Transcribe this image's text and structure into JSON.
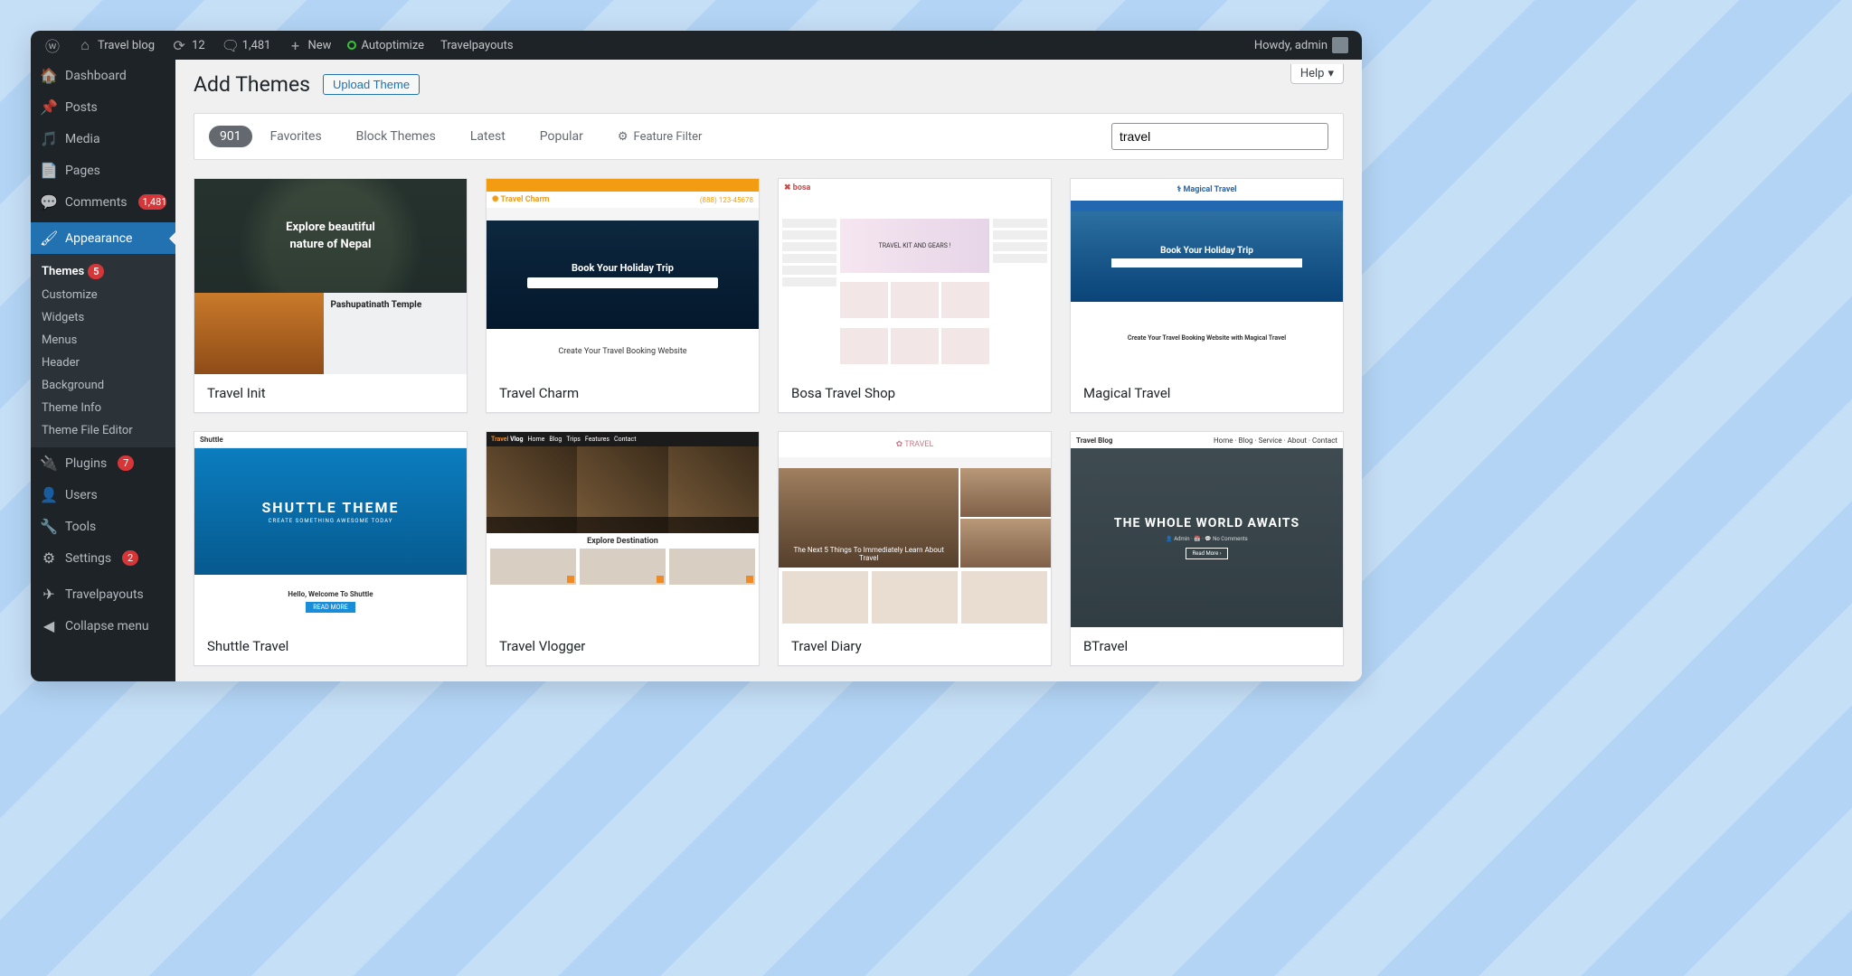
{
  "adminbar": {
    "site_name": "Travel blog",
    "updates": "12",
    "comments": "1,481",
    "new_label": "New",
    "autoptimize": "Autoptimize",
    "travelpayouts": "Travelpayouts",
    "howdy_label": "Howdy, admin"
  },
  "sidebar": {
    "items": [
      {
        "icon": "🏠",
        "label": "Dashboard"
      },
      {
        "icon": "📌",
        "label": "Posts"
      },
      {
        "icon": "🎵",
        "label": "Media"
      },
      {
        "icon": "📄",
        "label": "Pages"
      },
      {
        "icon": "💬",
        "label": "Comments",
        "badge": "1,481"
      },
      {
        "icon": "🖌",
        "label": "Appearance",
        "current": true
      },
      {
        "icon": "🔌",
        "label": "Plugins",
        "badge": "7"
      },
      {
        "icon": "👤",
        "label": "Users"
      },
      {
        "icon": "🔧",
        "label": "Tools"
      },
      {
        "icon": "⚙",
        "label": "Settings",
        "badge": "2"
      },
      {
        "icon": "✈",
        "label": "Travelpayouts"
      },
      {
        "icon": "◀",
        "label": "Collapse menu"
      }
    ],
    "appearance_submenu": [
      {
        "label": "Themes",
        "badge": "5",
        "current": true
      },
      {
        "label": "Customize"
      },
      {
        "label": "Widgets"
      },
      {
        "label": "Menus"
      },
      {
        "label": "Header"
      },
      {
        "label": "Background"
      },
      {
        "label": "Theme Info"
      },
      {
        "label": "Theme File Editor"
      }
    ]
  },
  "page": {
    "help": "Help",
    "title": "Add Themes",
    "upload_label": "Upload Theme",
    "count": "901",
    "filters": [
      "Popular",
      "Latest",
      "Block Themes",
      "Favorites"
    ],
    "feature_filter": "Feature Filter",
    "search_value": "travel"
  },
  "themes": [
    {
      "name": "Travel Init",
      "kind": "nepal",
      "caption1": "Explore beautiful",
      "caption2": "nature of Nepal",
      "sub": "Pashupatinath Temple"
    },
    {
      "name": "Travel Charm",
      "kind": "charm",
      "logo": "Travel Charm",
      "phone": "(888) 123-45678",
      "caption": "Book Your Holiday Trip",
      "foot": "Create Your Travel Booking Website"
    },
    {
      "name": "Bosa Travel Shop",
      "kind": "bosa",
      "logo": "bosa",
      "caption": "TRAVEL KIT AND GEARS !"
    },
    {
      "name": "Magical Travel",
      "kind": "magical",
      "logo": "Magical Travel",
      "caption": "Book Your Holiday Trip",
      "foot": "Create Your Travel Booking Website with Magical Travel"
    },
    {
      "name": "Shuttle Travel",
      "kind": "shuttle",
      "logo": "Shuttle",
      "caption": "SHUTTLE THEME",
      "tag": "CREATE SOMETHING AWESOME TODAY",
      "foot": "Hello, Welcome To Shuttle"
    },
    {
      "name": "Travel Vlogger",
      "kind": "vlogger",
      "brand1": "Travel",
      "brand2": "Vlog",
      "caption": "Explore Destination"
    },
    {
      "name": "Travel Diary",
      "kind": "diary",
      "logo": "TRAVEL",
      "caption": "The Next 5 Things To Immediately Learn About Travel"
    },
    {
      "name": "BTravel",
      "kind": "btravel",
      "logo": "Travel Blog",
      "caption": "THE WHOLE WORLD AWAITS",
      "btn": "Read More ›"
    }
  ]
}
